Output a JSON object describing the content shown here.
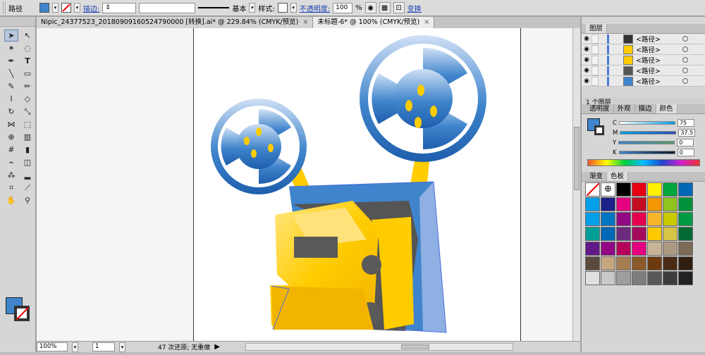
{
  "control_bar": {
    "object_type": "路径",
    "stroke_link": "描边:",
    "stroke_profile": "基本",
    "style_label": "样式:",
    "opacity_link": "不透明度:",
    "opacity_value": "100",
    "opacity_unit": "%",
    "transform_link": "变换",
    "fill_color": "#3f84cc"
  },
  "tabs": [
    {
      "label": "Nipic_24377523_20180909160524790000 [转换].ai* @ 229.84% (CMYK/预览)",
      "close": "×"
    },
    {
      "label": "未标题-6* @ 100% (CMYK/预览)",
      "close": "×"
    }
  ],
  "status_bar": {
    "zoom": "100%",
    "artboard": "1",
    "message": "47 次还原; 无重做"
  },
  "layers_panel": {
    "title": "图层",
    "rows": [
      "<路径>",
      "<路径>",
      "<路径>",
      "<路径>",
      "<路径>"
    ],
    "footer": "1 个图层"
  },
  "color_panel": {
    "tabs": [
      "透明度",
      "外观",
      "描边",
      "颜色"
    ],
    "active_tab": "颜色",
    "channels": [
      {
        "name": "C",
        "value": "75"
      },
      {
        "name": "M",
        "value": "37.5"
      },
      {
        "name": "Y",
        "value": "0"
      },
      {
        "name": "K",
        "value": "0"
      }
    ]
  },
  "swatch_panel": {
    "tabs": [
      "渐变",
      "色板"
    ],
    "active_tab": "色板",
    "colors": [
      "#ffffff",
      "#ffffff",
      "#000000",
      "#e60012",
      "#fff100",
      "#00a73c",
      "#0068b7",
      "#00a0e9",
      "#1d2088",
      "#e4007f",
      "#c30d23",
      "#f39800",
      "#8fc31f",
      "#00913a",
      "#00a0e9",
      "#0075c2",
      "#920783",
      "#e5004f",
      "#f8b62d",
      "#c9ca00",
      "#009944",
      "#009e96",
      "#0068b7",
      "#6c2c7e",
      "#a40b5d",
      "#fcc800",
      "#d7c447",
      "#006934",
      "#601986",
      "#920783",
      "#b5005b",
      "#e4007f",
      "#c9b497",
      "#ab9a81",
      "#7c6a55",
      "#5b4a3c",
      "#c7a580",
      "#a67c52",
      "#8b5a2b",
      "#6d3a0f",
      "#4a2c16",
      "#301e10",
      "#e0e0e0",
      "#c9c9c9",
      "#9e9e9e",
      "#7d7d7d",
      "#595959",
      "#3d3d3d",
      "#222222"
    ]
  },
  "tools": [
    "selection-arrow",
    "direct-selection-arrow",
    "magic-wand",
    "lasso",
    "pen",
    "type",
    "line",
    "rectangle",
    "paintbrush",
    "pencil",
    "blob-brush",
    "eraser",
    "rotate",
    "scale",
    "width",
    "free-transform",
    "shape-builder",
    "perspective",
    "mesh",
    "gradient",
    "eyedropper",
    "blend",
    "symbol-sprayer",
    "column-graph",
    "artboard",
    "slice",
    "hand",
    "zoom"
  ]
}
